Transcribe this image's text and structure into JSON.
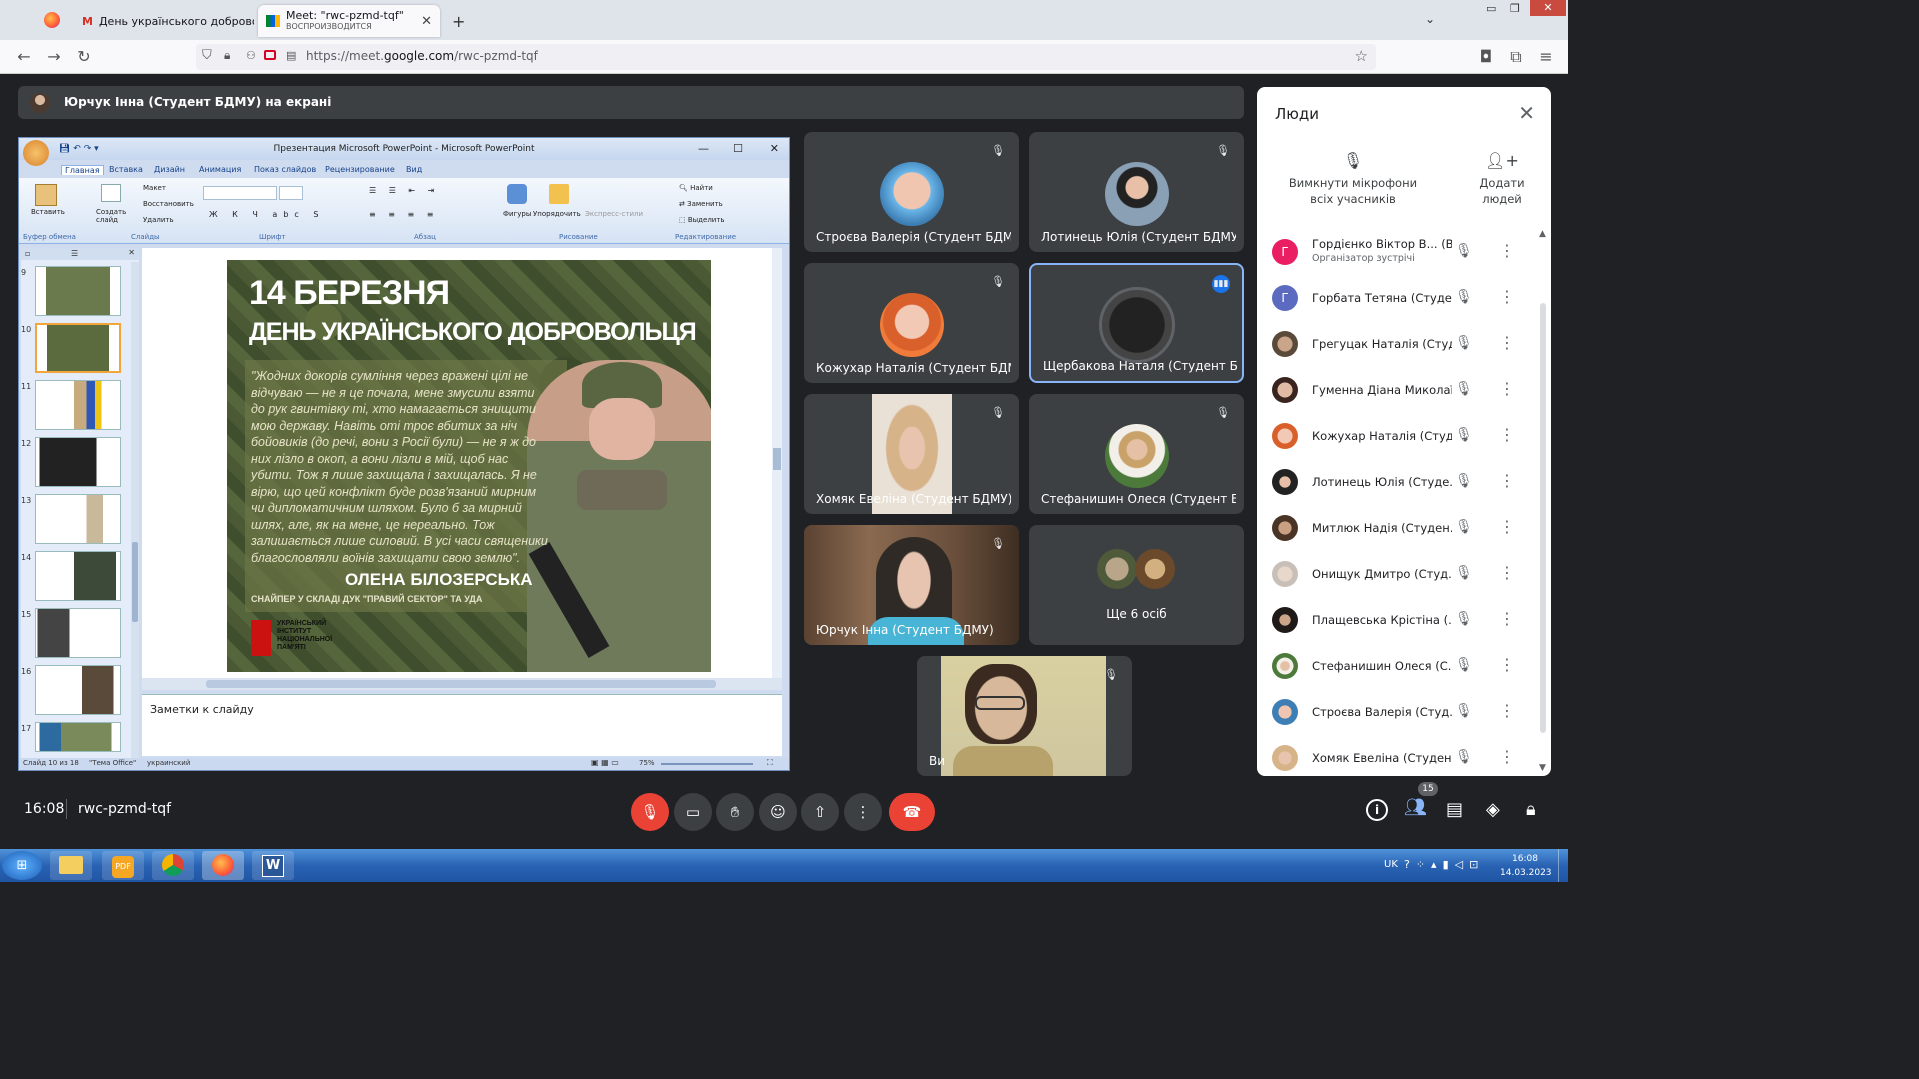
{
  "browser": {
    "tab1_title": "День українського доброволь",
    "tab2_title": "Meet: \"rwc-pzmd-tqf\"",
    "tab2_subtitle": "ВОСПРОИЗВОДИТСЯ",
    "url_prefix": "https://meet.",
    "url_domain": "google.com",
    "url_suffix": "/rwc-pzmd-tqf"
  },
  "meet": {
    "presenter_label": "Юрчук Інна (Студент БДМУ) на екрані",
    "time": "16:08",
    "code": "rwc-pzmd-tqf",
    "people_count": "15"
  },
  "ppt": {
    "window_title": "Презентация Microsoft PowerPoint - Microsoft PowerPoint",
    "tabs": [
      "Главная",
      "Вставка",
      "Дизайн",
      "Анимация",
      "Показ слайдов",
      "Рецензирование",
      "Вид"
    ],
    "groups": [
      "Буфер обмена",
      "Слайды",
      "Шрифт",
      "Абзац",
      "Рисование",
      "Редактирование"
    ],
    "buttons": {
      "paste": "Вставить",
      "new_slide": "Создать слайд",
      "layout": "Макет",
      "reset": "Восстановить",
      "delete": "Удалить",
      "shapes": "Фигуры",
      "arrange": "Упорядочить",
      "quick_styles": "Экспресс-стили",
      "find": "Найти",
      "replace": "Заменить",
      "select": "Выделить"
    },
    "thumb_numbers": [
      "9",
      "10",
      "11",
      "12",
      "13",
      "14",
      "15",
      "16",
      "17"
    ],
    "notes": "Заметки к слайду",
    "status": {
      "slide": "Слайд 10 из 18",
      "theme": "\"Тема Office\"",
      "lang": "украинский",
      "zoom": "75%"
    }
  },
  "slide": {
    "line1": "14 БЕРЕЗНЯ",
    "line2": "ДЕНЬ УКРАЇНСЬКОГО ДОБРОВОЛЬЦЯ",
    "quote": "\"Жодних докорів сумління через вражені цілі не відчуваю — не я це почала, мене змусили взяти до рук гвинтівку ті, хто намагається знищити мою державу. Навіть оті троє вбитих за ніч бойовиків (до речі, вони з Росії були) — не я ж до них лізло в окоп, а вони лізли в мій, щоб нас убити. Тож я лише захищала і захищалась. Я не вірю, що цей конфлікт буде розв'язаний мирним чи дипломатичним шляхом. Було б за мирний шлях, але, як на мене, це нереально. Тож залишається лише силовий. В усі часи священики благословляли воїнів захищати свою землю\".",
    "author": "ОЛЕНА БІЛОЗЕРСЬКА",
    "role": "СНАЙПЕР У СКЛАДІ ДУК \"ПРАВИЙ СЕКТОР\" ТА УДА",
    "institute": "УКРАЇНСЬКИЙ ІНСТИТУТ НАЦІОНАЛЬНОЇ ПАМ'ЯТІ"
  },
  "tiles": [
    "Строєва Валерія (Студент БДМ...",
    "Лотинець Юлія (Студент БДМУ)",
    "Кожухар Наталія (Студент БДМ...",
    "Щербакова Наталя (Студент Б...",
    "Хомяк Евеліна (Студент БДМУ)",
    "Стефанишин Олеся (Студент Б...",
    "Юрчук Інна (Студент БДМУ)",
    "Ще 6 осіб",
    "Ви"
  ],
  "people": {
    "title": "Люди",
    "mute_all": "Вимкнути мікрофони всіх учасників",
    "add": "Додати людей",
    "list": [
      {
        "name": "Гордієнко Віктор В... (Ви)",
        "sub": "Організатор зустрічі",
        "initial": "Г",
        "color": "#e91e63"
      },
      {
        "name": "Горбата Тетяна (Студе...",
        "initial": "Г",
        "color": "#5c6bc0"
      },
      {
        "name": "Грегуцак Наталія (Студ..."
      },
      {
        "name": "Гуменна Діана Миколаї..."
      },
      {
        "name": "Кожухар Наталія (Студ..."
      },
      {
        "name": "Лотинець Юлія (Студе..."
      },
      {
        "name": "Митлюк Надія (Студен..."
      },
      {
        "name": "Онищук Дмитро (Студ..."
      },
      {
        "name": "Плащевська Крістіна (..."
      },
      {
        "name": "Стефанишин Олеся (С..."
      },
      {
        "name": "Строєва Валерія (Студ..."
      },
      {
        "name": "Хомяк Евеліна (Студен..."
      }
    ]
  },
  "taskbar": {
    "lang": "UK",
    "time": "16:08",
    "date": "14.03.2023"
  },
  "colors": {
    "meet_bg": "#202124",
    "tile_bg": "#3c4043",
    "end_call": "#ea4335",
    "active_speaker": "#8ab4f8"
  }
}
